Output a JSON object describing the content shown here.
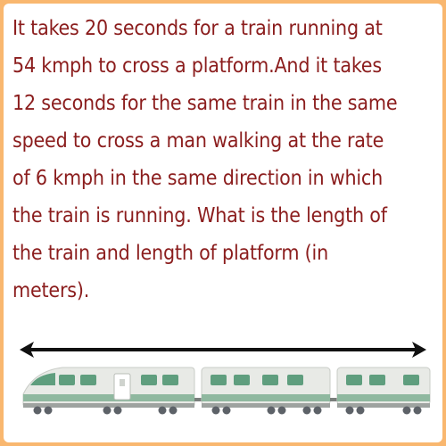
{
  "question": {
    "lines": [
      "It takes 20 seconds for a train running at",
      "54 kmph to cross a platform.And it takes",
      "12 seconds for the same train in the same",
      "speed to cross a man walking at the rate",
      "of 6 kmph in the same direction in which",
      "the train is running. What is the length of",
      "the train and length of platform (in",
      "meters)."
    ]
  },
  "illustration": {
    "arrow": "double-headed-arrow",
    "train": "train-icon",
    "colors": {
      "border": "#f9b76f",
      "text": "#8b1d1d",
      "train_body": "#e8eae6",
      "train_stripe": "#8fb89f",
      "train_window": "#5f9e7e",
      "wheel": "#5d6268"
    }
  }
}
